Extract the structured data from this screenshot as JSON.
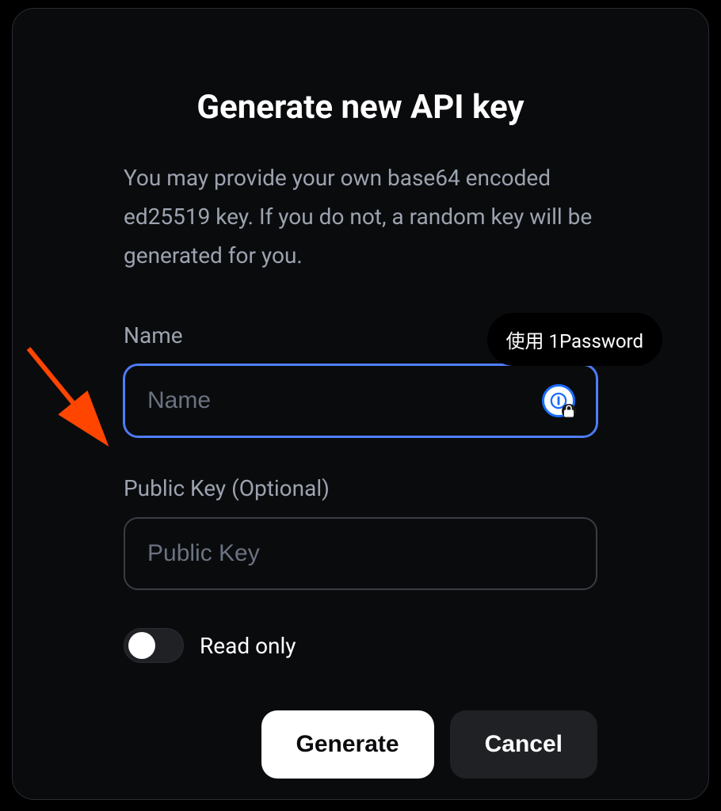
{
  "modal": {
    "title": "Generate new API key",
    "description": "You may provide your own base64 encoded ed25519 key. If you do not, a random key will be generated for you."
  },
  "form": {
    "name": {
      "label": "Name",
      "placeholder": "Name",
      "value": ""
    },
    "public_key": {
      "label": "Public Key (Optional)",
      "placeholder": "Public Key",
      "value": ""
    },
    "read_only": {
      "label": "Read only",
      "checked": false
    }
  },
  "tooltip": {
    "text": "使用 1Password"
  },
  "buttons": {
    "generate": "Generate",
    "cancel": "Cancel"
  }
}
